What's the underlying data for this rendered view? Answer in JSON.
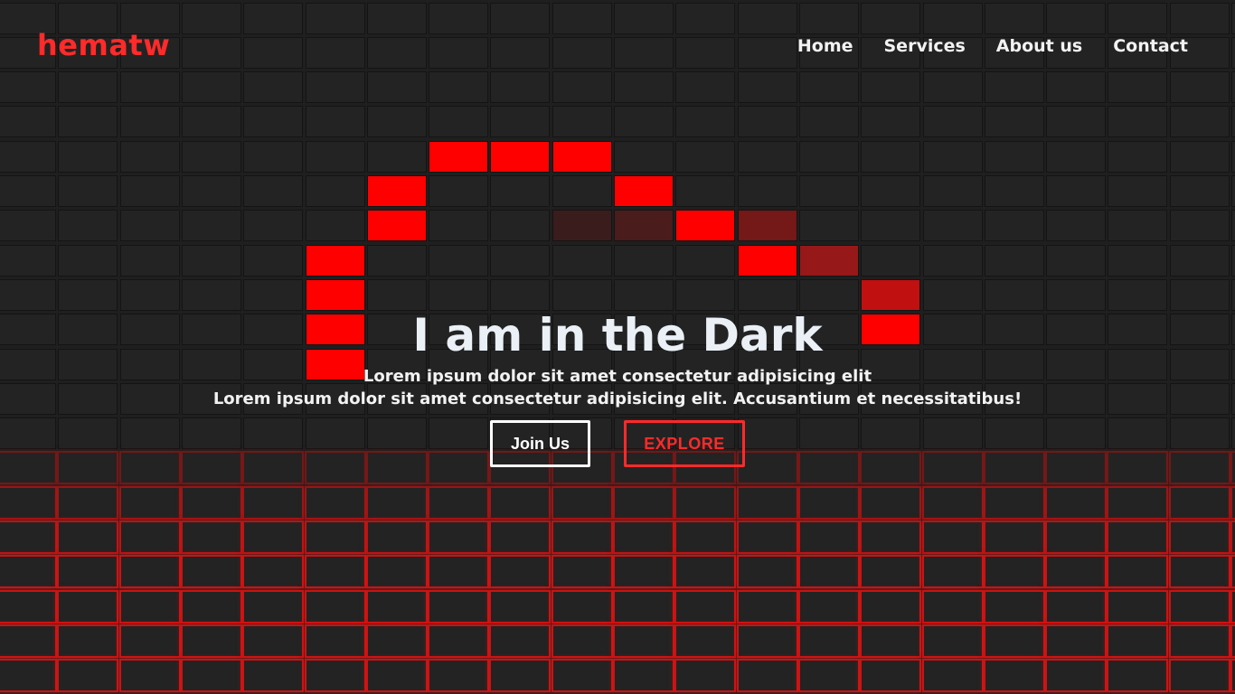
{
  "brand": {
    "logo": "hematw",
    "accent_color": "#ff2a2a"
  },
  "nav": {
    "items": [
      {
        "label": "Home"
      },
      {
        "label": "Services"
      },
      {
        "label": "About us"
      },
      {
        "label": "Contact"
      }
    ]
  },
  "hero": {
    "title": "I am in the Dark",
    "line1": "Lorem ipsum dolor sit amet consectetur adipisicing elit",
    "line2": "Lorem ipsum dolor sit amet consectetur adipisicing elit. Accusantium et necessitatibus!"
  },
  "buttons": {
    "join_label": "Join Us",
    "explore_label": "EXPLORE"
  },
  "colors": {
    "background": "#1f1f1f",
    "tile": "#232323",
    "highlight_red": "#ff0000",
    "grid_glow": "#b01010"
  }
}
